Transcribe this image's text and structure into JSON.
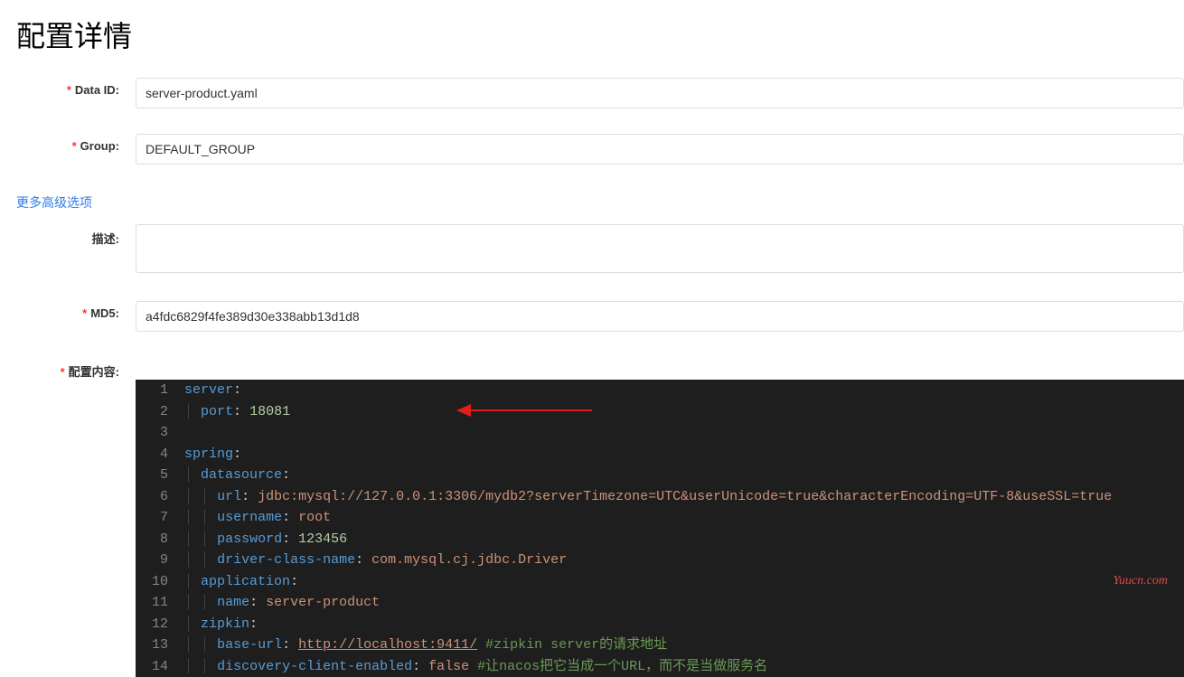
{
  "page_title": "配置详情",
  "labels": {
    "data_id": "Data ID:",
    "group": "Group:",
    "more": "更多高级选项",
    "desc": "描述:",
    "md5": "MD5:",
    "content": "配置内容:"
  },
  "values": {
    "data_id": "server-product.yaml",
    "group": "DEFAULT_GROUP",
    "desc": "",
    "md5": "a4fdc6829f4fe389d30e338abb13d1d8"
  },
  "code": {
    "lines": [
      [
        {
          "t": "key",
          "v": "server"
        },
        {
          "t": "plain",
          "v": ":"
        }
      ],
      [
        {
          "t": "plain",
          "v": "  "
        },
        {
          "t": "key",
          "v": "port"
        },
        {
          "t": "plain",
          "v": ": "
        },
        {
          "t": "num",
          "v": "18081"
        }
      ],
      [
        {
          "t": "plain",
          "v": ""
        }
      ],
      [
        {
          "t": "key",
          "v": "spring"
        },
        {
          "t": "plain",
          "v": ":"
        }
      ],
      [
        {
          "t": "plain",
          "v": "  "
        },
        {
          "t": "key",
          "v": "datasource"
        },
        {
          "t": "plain",
          "v": ":"
        }
      ],
      [
        {
          "t": "plain",
          "v": "    "
        },
        {
          "t": "key",
          "v": "url"
        },
        {
          "t": "plain",
          "v": ": "
        },
        {
          "t": "str",
          "v": "jdbc:mysql://127.0.0.1:3306/mydb2?serverTimezone=UTC&userUnicode=true&characterEncoding=UTF-8&useSSL=true"
        }
      ],
      [
        {
          "t": "plain",
          "v": "    "
        },
        {
          "t": "key",
          "v": "username"
        },
        {
          "t": "plain",
          "v": ": "
        },
        {
          "t": "str",
          "v": "root"
        }
      ],
      [
        {
          "t": "plain",
          "v": "    "
        },
        {
          "t": "key",
          "v": "password"
        },
        {
          "t": "plain",
          "v": ": "
        },
        {
          "t": "num",
          "v": "123456"
        }
      ],
      [
        {
          "t": "plain",
          "v": "    "
        },
        {
          "t": "key",
          "v": "driver-class-name"
        },
        {
          "t": "plain",
          "v": ": "
        },
        {
          "t": "str",
          "v": "com.mysql.cj.jdbc.Driver"
        }
      ],
      [
        {
          "t": "plain",
          "v": "  "
        },
        {
          "t": "key",
          "v": "application"
        },
        {
          "t": "plain",
          "v": ":"
        }
      ],
      [
        {
          "t": "plain",
          "v": "    "
        },
        {
          "t": "key",
          "v": "name"
        },
        {
          "t": "plain",
          "v": ": "
        },
        {
          "t": "str",
          "v": "server-product"
        }
      ],
      [
        {
          "t": "plain",
          "v": "  "
        },
        {
          "t": "key",
          "v": "zipkin"
        },
        {
          "t": "plain",
          "v": ":"
        }
      ],
      [
        {
          "t": "plain",
          "v": "    "
        },
        {
          "t": "key",
          "v": "base-url"
        },
        {
          "t": "plain",
          "v": ": "
        },
        {
          "t": "url",
          "v": "http://localhost:9411/"
        },
        {
          "t": "plain",
          "v": " "
        },
        {
          "t": "comment",
          "v": "#zipkin server的请求地址"
        }
      ],
      [
        {
          "t": "plain",
          "v": "    "
        },
        {
          "t": "key",
          "v": "discovery-client-enabled"
        },
        {
          "t": "plain",
          "v": ": "
        },
        {
          "t": "str",
          "v": "false"
        },
        {
          "t": "plain",
          "v": " "
        },
        {
          "t": "comment",
          "v": "#让nacos把它当成一个URL，而不是当做服务名"
        }
      ]
    ]
  },
  "watermark": "Yuucn.com"
}
